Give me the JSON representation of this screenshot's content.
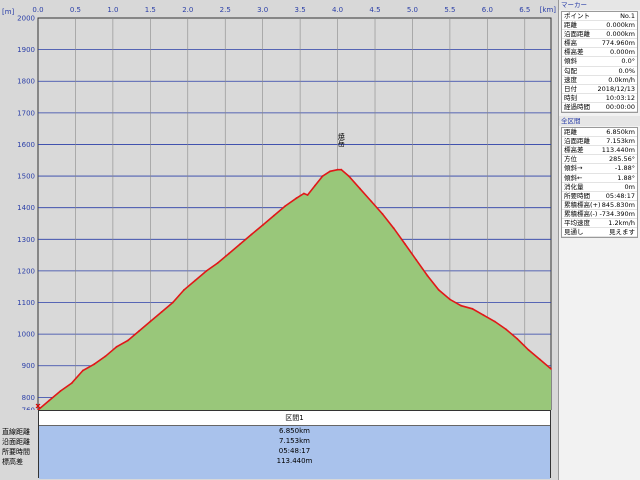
{
  "chart_data": {
    "type": "area",
    "x_unit": "[km]",
    "y_unit": "[m]",
    "xlim": [
      0,
      6.85
    ],
    "ylim": [
      760,
      2000
    ],
    "x_ticks": [
      "0.0",
      "0.5",
      "1.0",
      "1.5",
      "2.0",
      "2.5",
      "3.0",
      "3.5",
      "4.0",
      "4.5",
      "5.0",
      "5.5",
      "6.0",
      "6.5"
    ],
    "y_ticks": [
      "2000",
      "1900",
      "1800",
      "1700",
      "1600",
      "1500",
      "1400",
      "1300",
      "1200",
      "1100",
      "1000",
      "900",
      "800",
      "760"
    ],
    "series": [
      {
        "x": [
          0.0,
          0.15,
          0.3,
          0.45,
          0.6,
          0.75,
          0.9,
          1.05,
          1.2,
          1.35,
          1.5,
          1.65,
          1.8,
          1.95,
          2.1,
          2.25,
          2.4,
          2.55,
          2.7,
          2.85,
          3.0,
          3.15,
          3.3,
          3.45,
          3.55,
          3.6,
          3.7,
          3.8,
          3.9,
          4.0,
          4.05,
          4.15,
          4.3,
          4.45,
          4.6,
          4.75,
          4.9,
          5.05,
          5.2,
          5.35,
          5.5,
          5.65,
          5.8,
          5.95,
          6.1,
          6.25,
          6.4,
          6.55,
          6.7,
          6.85
        ],
        "y": [
          760,
          790,
          820,
          845,
          885,
          905,
          930,
          960,
          980,
          1010,
          1040,
          1070,
          1100,
          1140,
          1170,
          1200,
          1225,
          1255,
          1285,
          1315,
          1345,
          1375,
          1405,
          1430,
          1445,
          1440,
          1470,
          1500,
          1515,
          1520,
          1520,
          1500,
          1460,
          1420,
          1380,
          1335,
          1285,
          1235,
          1185,
          1140,
          1110,
          1090,
          1080,
          1060,
          1040,
          1015,
          985,
          950,
          920,
          890
        ]
      }
    ],
    "annotation": {
      "x": 4.05,
      "y": 1520,
      "label": "焼岳"
    },
    "fill_color": "#99c77a",
    "line_color": "#e01818",
    "plot_bg": "#d9d9d9",
    "grid_color": "#2b3fa8",
    "grid": true
  },
  "summary": {
    "header": "区間1",
    "rows": [
      {
        "label": "直線距離",
        "value": "6.850km"
      },
      {
        "label": "沿面距離",
        "value": "7.153km"
      },
      {
        "label": "所要時間",
        "value": "05:48:17"
      },
      {
        "label": "標高差",
        "value": "113.440m"
      }
    ]
  },
  "side": {
    "marker_title": "マーカー",
    "marker_rows": [
      {
        "k": "ポイント",
        "v": "No.1"
      },
      {
        "k": "距離",
        "v": "0.000km"
      },
      {
        "k": "沿面距離",
        "v": "0.000km"
      },
      {
        "k": "標高",
        "v": "774.960m"
      },
      {
        "k": "標高差",
        "v": "0.000m"
      },
      {
        "k": "傾斜",
        "v": "0.0°"
      },
      {
        "k": "勾配",
        "v": "0.0%"
      },
      {
        "k": "速度",
        "v": "0.0km/h"
      },
      {
        "k": "日付",
        "v": "2018/12/13"
      },
      {
        "k": "時刻",
        "v": "10:03:12"
      },
      {
        "k": "経過時間",
        "v": "00:00:00"
      }
    ],
    "all_title": "全区間",
    "all_rows": [
      {
        "k": "距離",
        "v": "6.850km"
      },
      {
        "k": "沿面距離",
        "v": "7.153km"
      },
      {
        "k": "標高差",
        "v": "113.440m"
      },
      {
        "k": "方位",
        "v": "285.56°"
      },
      {
        "k": "傾斜→",
        "v": "-1.88°"
      },
      {
        "k": "傾斜←",
        "v": "1.88°"
      },
      {
        "k": "消化量",
        "v": "0m"
      },
      {
        "k": "所要時間",
        "v": "05:48:17"
      },
      {
        "k": "累積標高(+)",
        "v": "845.830m"
      },
      {
        "k": "累積標高(-)",
        "v": "-734.390m"
      },
      {
        "k": "平均速度",
        "v": "1.2km/h"
      },
      {
        "k": "見通し",
        "v": "見えます"
      }
    ]
  }
}
